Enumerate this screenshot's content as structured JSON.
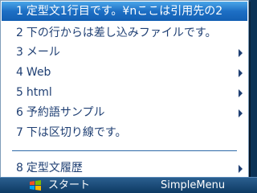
{
  "menu": {
    "items": [
      {
        "num": "1",
        "label": "定型文1行目です。¥nここは引用先の2",
        "submenu": false,
        "selected": true
      },
      {
        "num": "2",
        "label": "下の行からは差し込みファイルです。",
        "submenu": false,
        "selected": false
      },
      {
        "num": "3",
        "label": "メール",
        "submenu": true,
        "selected": false
      },
      {
        "num": "4",
        "label": "Web",
        "submenu": true,
        "selected": false
      },
      {
        "num": "5",
        "label": "html",
        "submenu": true,
        "selected": false
      },
      {
        "num": "6",
        "label": "予約語サンプル",
        "submenu": true,
        "selected": false
      },
      {
        "num": "7",
        "label": "下は区切り線です。",
        "submenu": false,
        "selected": false
      },
      {
        "num": "8",
        "label": "定型文履歴",
        "submenu": true,
        "selected": false
      }
    ]
  },
  "taskbar": {
    "start_label": "スタート",
    "right_softkey": "SimpleMenu"
  },
  "colors": {
    "selection": "#1d6fc4",
    "menu_text": "#1f3f73",
    "separator": "#2e6aa8"
  }
}
